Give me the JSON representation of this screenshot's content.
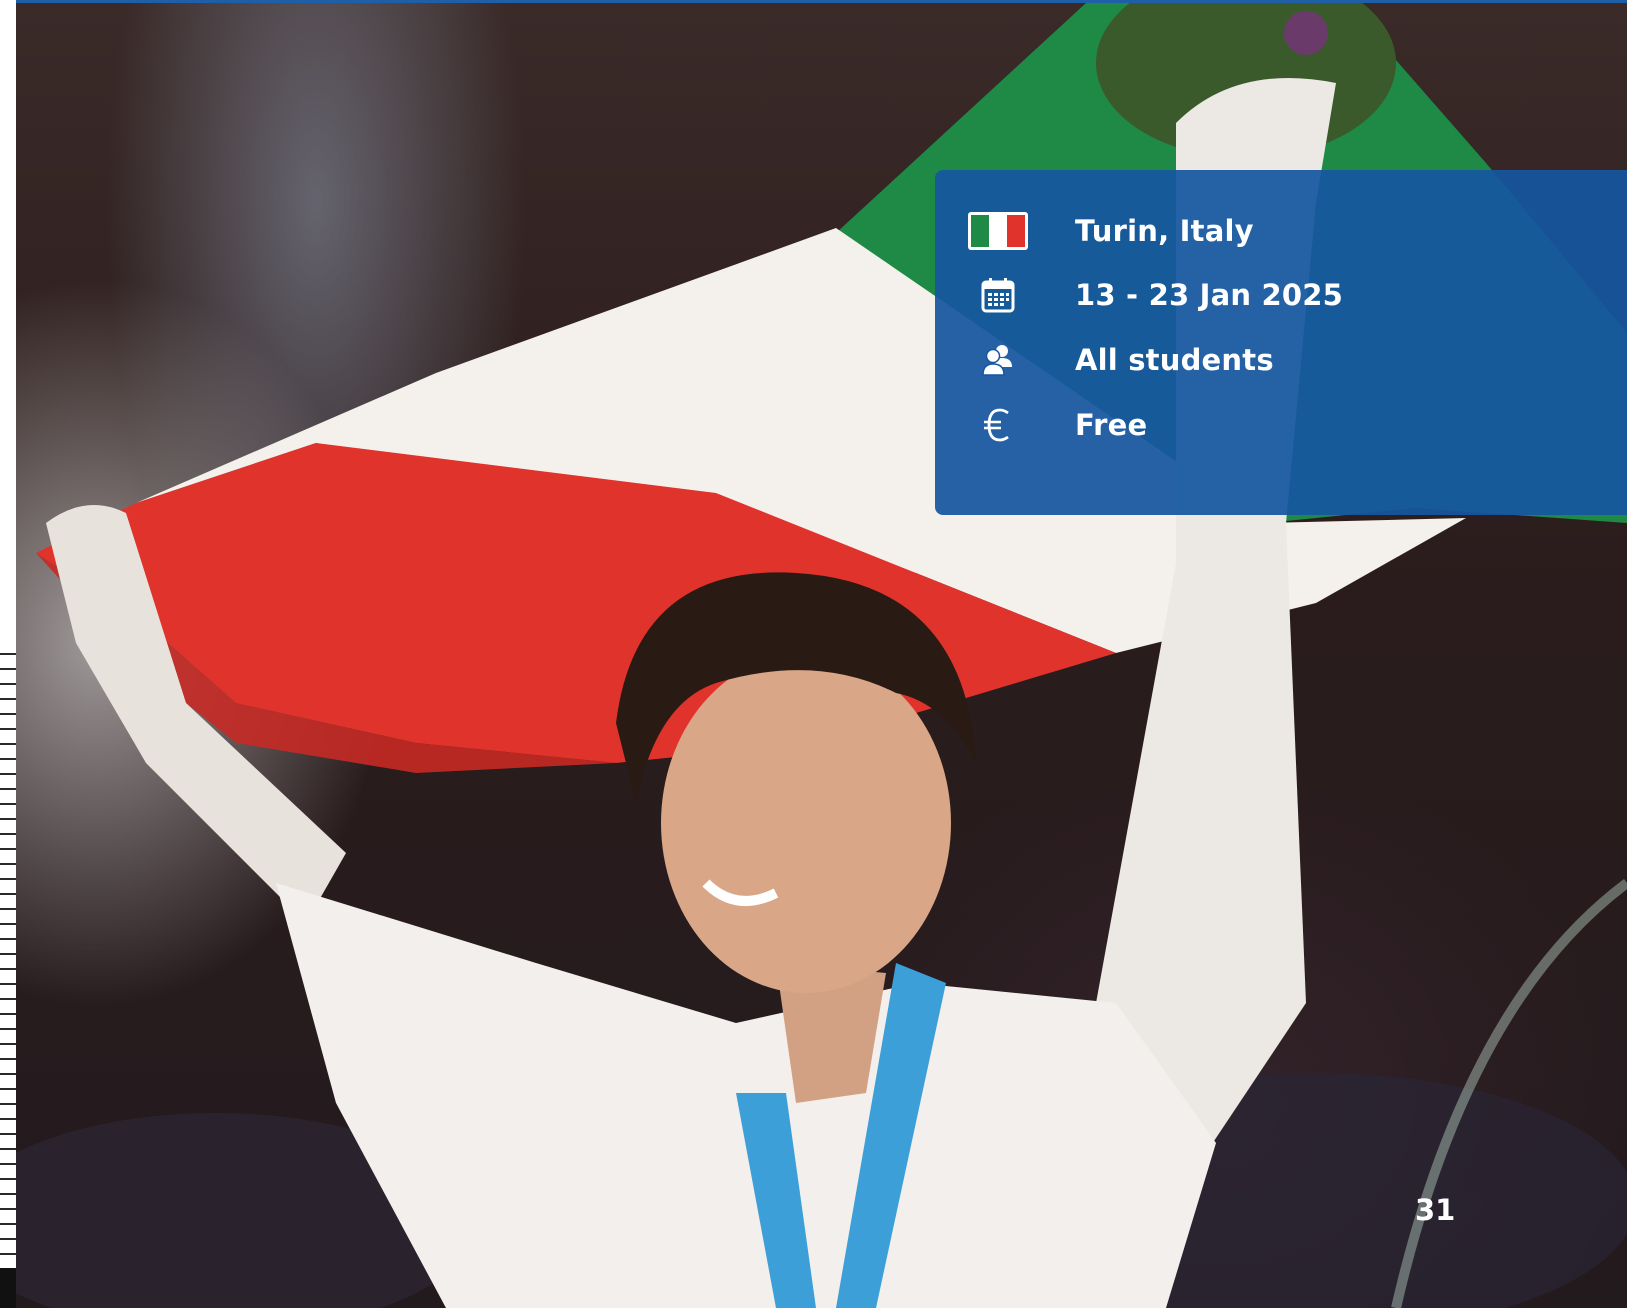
{
  "info_card": {
    "rows": [
      {
        "icon": "italy-flag-icon",
        "label": "Turin, Italy"
      },
      {
        "icon": "calendar-icon",
        "label": "13 - 23 Jan 2025"
      },
      {
        "icon": "people-icon",
        "label": "All students"
      },
      {
        "icon": "euro-icon",
        "label": "Free"
      }
    ]
  },
  "page_number": "31",
  "colors": {
    "card_background": "#1656a0",
    "top_rule": "#1f5fa8",
    "flag_green": "#1e8a46",
    "flag_white": "#f4f1ec",
    "flag_red": "#e0332c"
  }
}
